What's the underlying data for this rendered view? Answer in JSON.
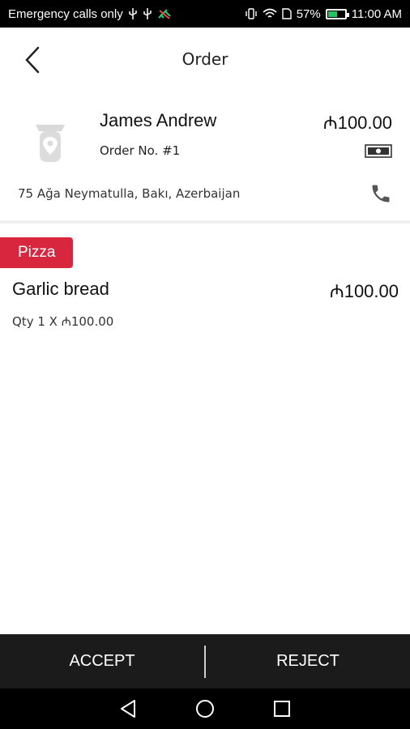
{
  "status_bar": {
    "carrier_text": "Emergency calls only",
    "battery_percent": "57%",
    "battery_level": 0.57,
    "time": "11:00 AM",
    "icons": [
      "usb-icon",
      "usb-icon",
      "no-signal-icon",
      "vibrate-icon",
      "wifi-icon",
      "sim-icon",
      "battery-icon"
    ]
  },
  "header": {
    "title": "Order",
    "back_icon": "back-arrow-icon"
  },
  "customer": {
    "name": "James Andrew",
    "order_number": "Order No. #1",
    "total": "₼100.00",
    "payment_icon": "cash-icon",
    "address": "75 Ağa Neymatulla, Bakı, Azerbaijan",
    "phone_icon": "phone-icon"
  },
  "order_items": {
    "category": "Pizza",
    "items": [
      {
        "name": "Garlic bread",
        "price": "₼100.00",
        "qty_line": "Qty 1 X ₼100.00"
      }
    ]
  },
  "actions": {
    "accept_label": "ACCEPT",
    "reject_label": "REJECT"
  },
  "colors": {
    "accent_red": "#d7263d",
    "action_bar": "#1b1b1b",
    "battery_green": "#22c55e"
  }
}
